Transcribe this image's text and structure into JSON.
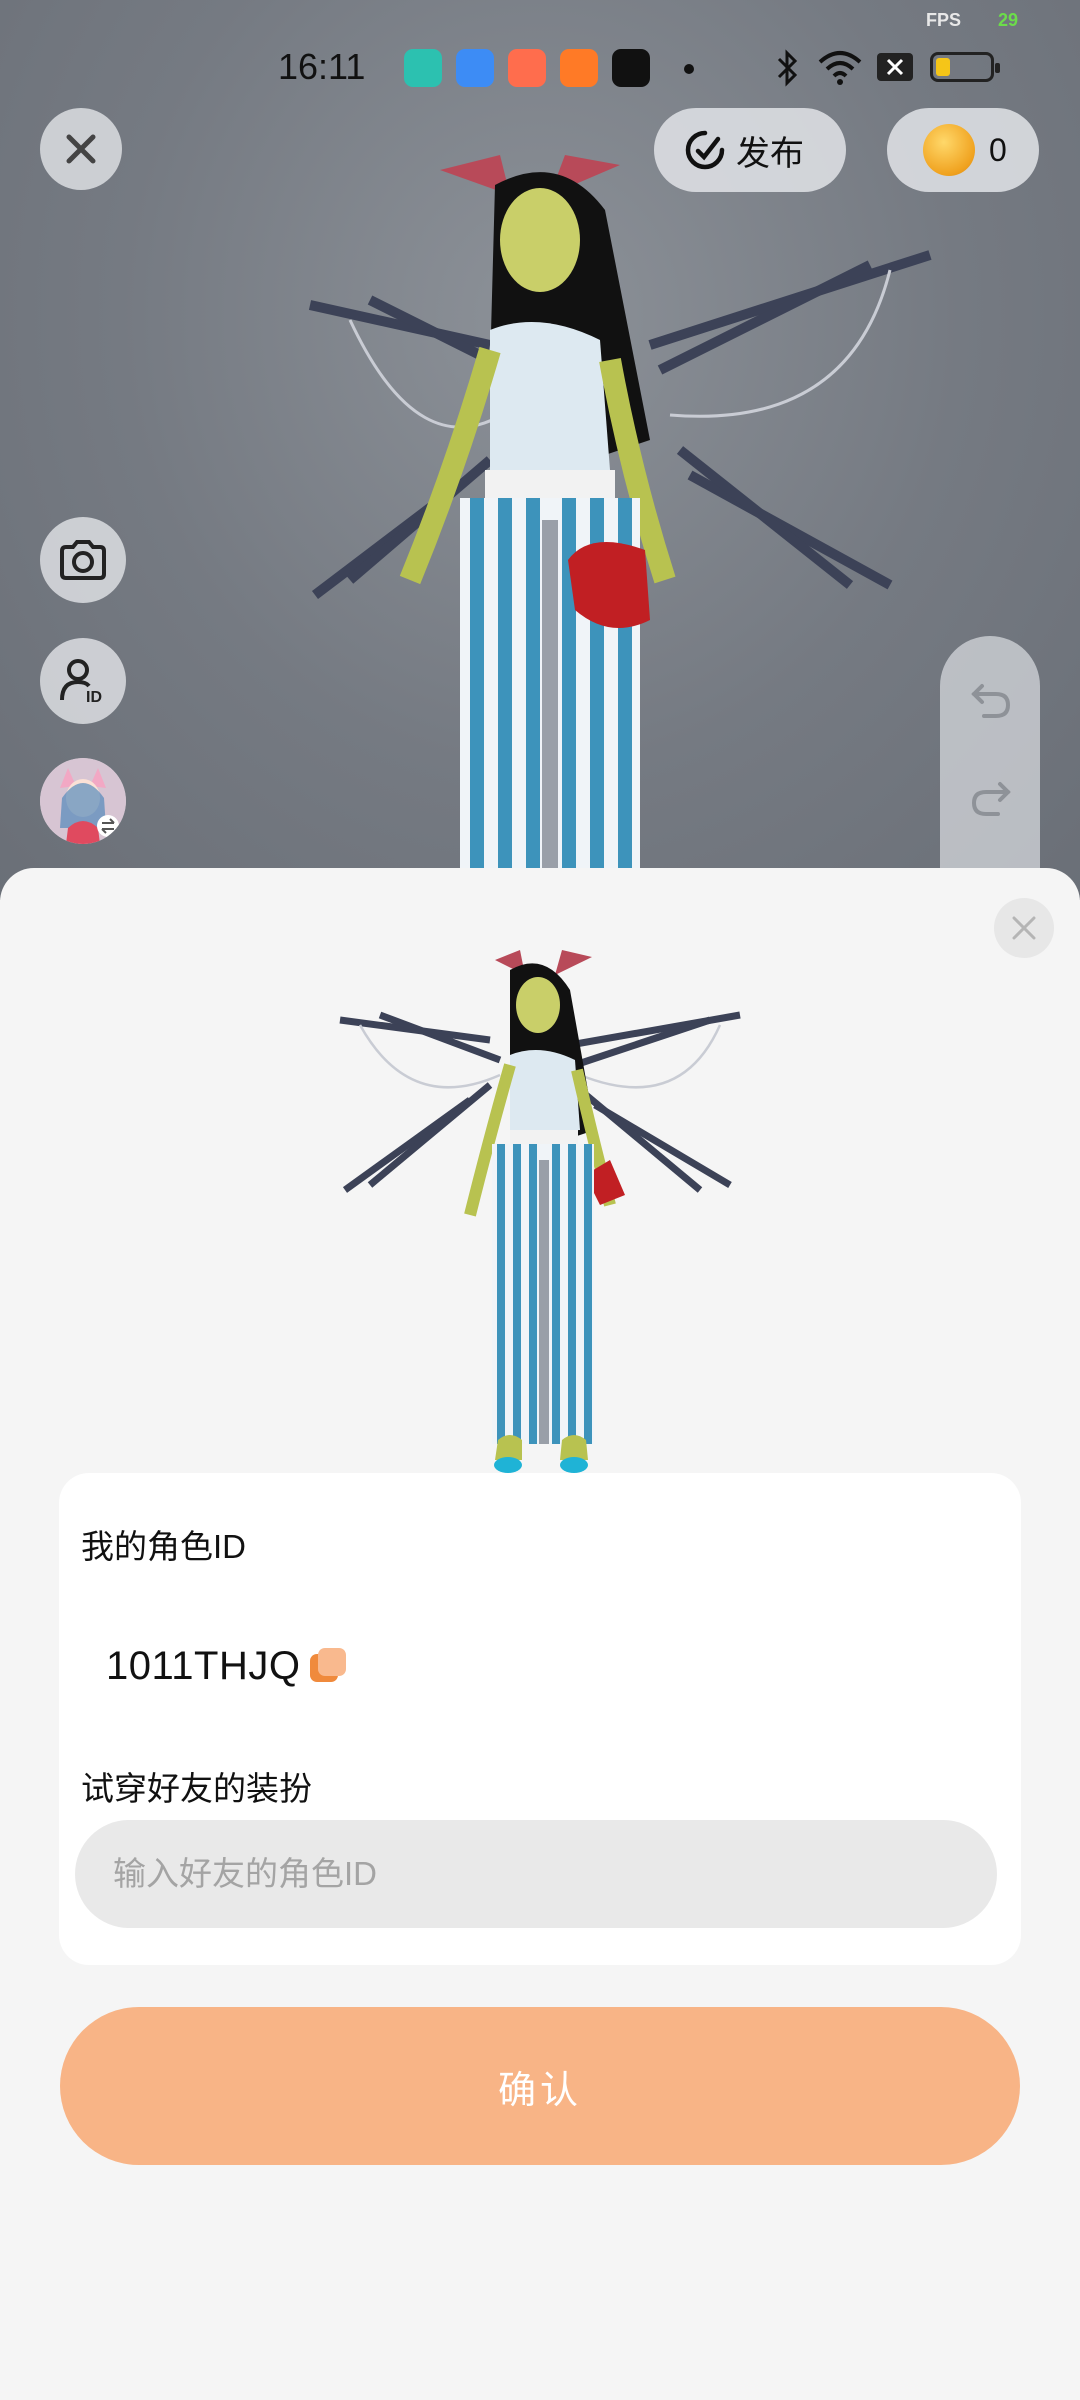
{
  "status_bar": {
    "time": "16:11",
    "fps_label": "FPS",
    "fps_value": "29"
  },
  "toolbar": {
    "publish_label": "发布",
    "coin_count": "0"
  },
  "sheet": {
    "my_id_label": "我的角色ID",
    "my_id_value": "1011THJQ",
    "try_on_label": "试穿好友的装扮",
    "friend_id_placeholder": "输入好友的角色ID",
    "confirm_label": "确认"
  },
  "colors": {
    "confirm_bg": "#f8b486",
    "accent_orange": "#f08a3c",
    "fps_green": "#6cdc4a"
  },
  "icons": [
    "close-icon",
    "publish-icon",
    "coin-icon",
    "camera-icon",
    "user-id-icon",
    "avatar-swap-icon",
    "undo-icon",
    "redo-icon",
    "copy-icon",
    "bluetooth-icon",
    "wifi-icon",
    "battery-icon"
  ]
}
